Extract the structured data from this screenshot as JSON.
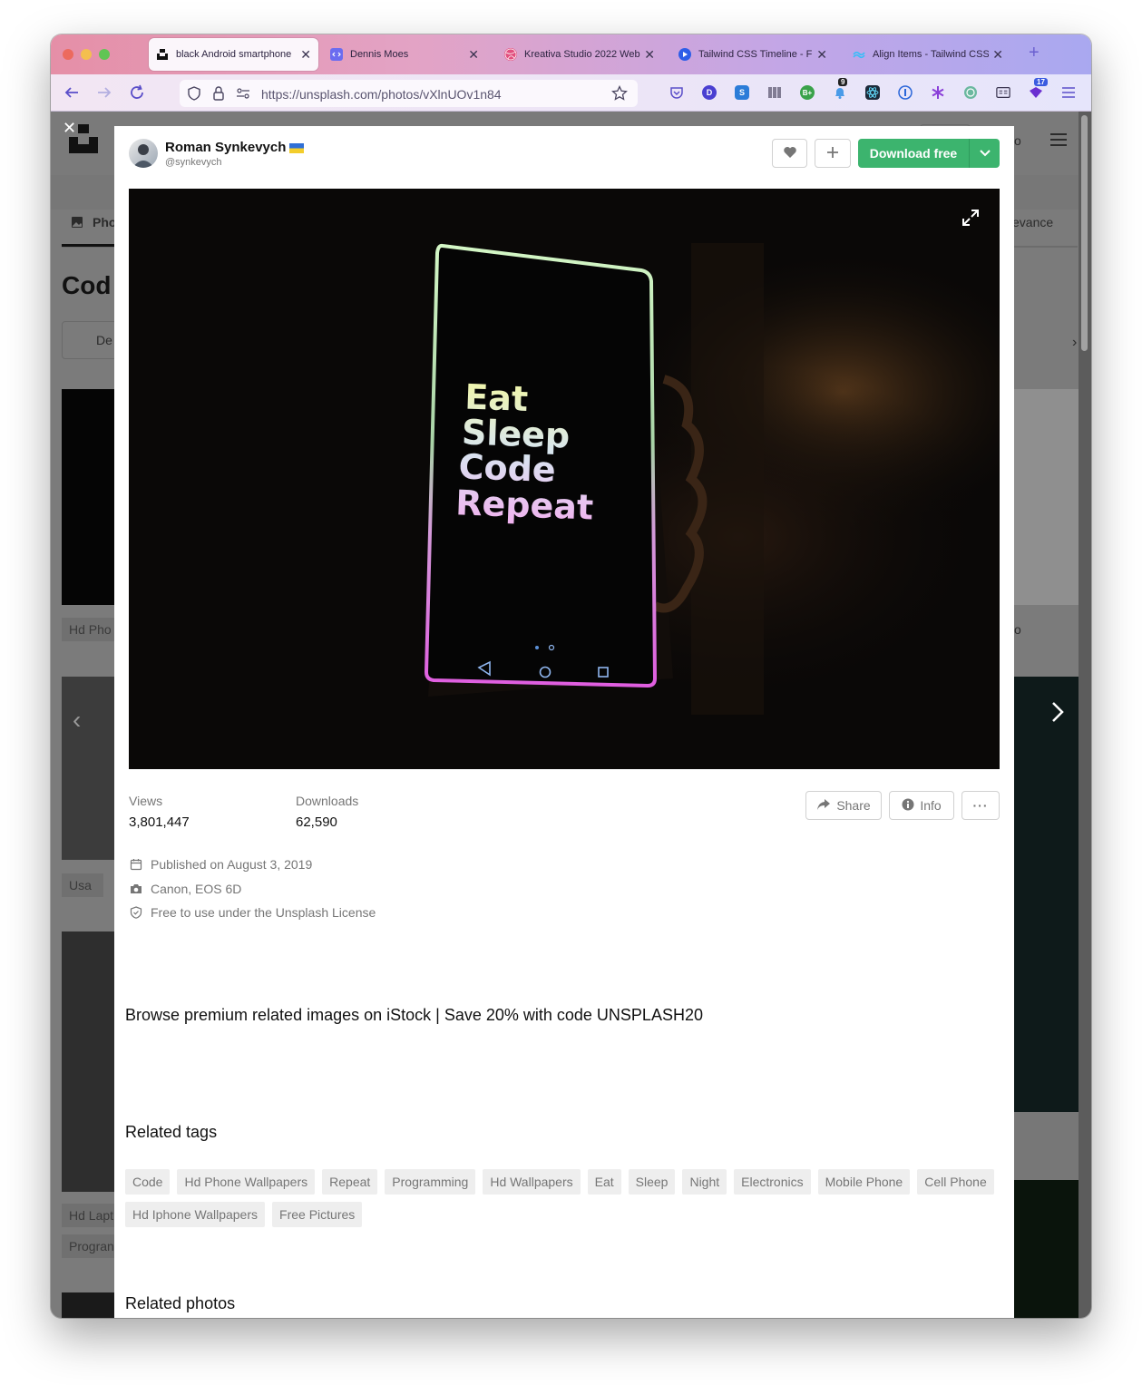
{
  "browser": {
    "tabs": [
      {
        "label": "black Android smartphone",
        "active": true
      },
      {
        "label": "Dennis Moes",
        "active": false
      },
      {
        "label": "Kreativa Studio 2022 Web",
        "active": false
      },
      {
        "label": "Tailwind CSS Timeline - Fl",
        "active": false
      },
      {
        "label": "Align Items - Tailwind CSS",
        "active": false
      }
    ],
    "new_tab": "+",
    "url": "https://unsplash.com/photos/vXlnUOv1n84",
    "extension_badges": {
      "bell": "9",
      "vpn": "17"
    },
    "extension_icons": [
      "pocket-icon",
      "d-ext-icon",
      "s-ext-icon",
      "barcode-icon",
      "bplus-icon",
      "bell-icon",
      "react-devtools-icon",
      "onepassword-icon",
      "snowflake-icon",
      "globe-icon",
      "reader-icon",
      "vpn-icon",
      "menu-icon"
    ],
    "colors": {
      "accent": "#5a4ec9"
    }
  },
  "background": {
    "partial_tab": "Pho",
    "partial_title": "Cod",
    "partial_button": "De",
    "partial_sort": "evance",
    "partial_tags": [
      "Hd Pho",
      "Usa",
      "Hd Lapt",
      "Progran"
    ],
    "partial_right": [
      "o",
      "o"
    ]
  },
  "modal": {
    "close_label": "✕",
    "user": {
      "name": "Roman Synkevych",
      "flag": "ukraine-flag",
      "handle": "@synkevych"
    },
    "like_label": "♥",
    "add_label": "+",
    "download_label": "Download free",
    "download_color": "#3cb46e",
    "photo": {
      "alt": "black Android smartphone",
      "screen_lines": [
        "Eat",
        "Sleep",
        "Code",
        "Repeat"
      ]
    },
    "stats": {
      "views_label": "Views",
      "views_value": "3,801,447",
      "downloads_label": "Downloads",
      "downloads_value": "62,590"
    },
    "share_label": "Share",
    "info_label": "Info",
    "more_label": "···",
    "meta": {
      "published": "Published on August 3, 2019",
      "camera": "Canon, EOS 6D",
      "license": "Free to use under the Unsplash License"
    },
    "promo": "Browse premium related images on iStock | Save 20% with code UNSPLASH20",
    "related_tags_title": "Related tags",
    "tags": [
      "Code",
      "Hd Phone Wallpapers",
      "Repeat",
      "Programming",
      "Hd Wallpapers",
      "Eat",
      "Sleep",
      "Night",
      "Electronics",
      "Mobile Phone",
      "Cell Phone",
      "Hd Iphone Wallpapers",
      "Free Pictures"
    ],
    "related_photos_title": "Related photos"
  }
}
